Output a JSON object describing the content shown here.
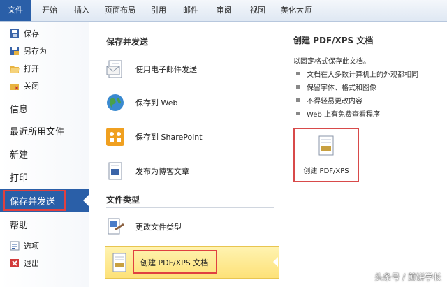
{
  "ribbon": {
    "tabs": [
      "文件",
      "开始",
      "插入",
      "页面布局",
      "引用",
      "邮件",
      "审阅",
      "视图",
      "美化大师"
    ]
  },
  "nav": {
    "small_items": [
      {
        "label": "保存",
        "icon": "save-icon"
      },
      {
        "label": "另存为",
        "icon": "save-as-icon"
      },
      {
        "label": "打开",
        "icon": "open-folder-icon"
      },
      {
        "label": "关闭",
        "icon": "close-folder-icon"
      }
    ],
    "big_items": [
      "信息",
      "最近所用文件",
      "新建",
      "打印",
      "保存并发送",
      "帮助"
    ],
    "bottom_items": [
      {
        "label": "选项",
        "icon": "options-icon"
      },
      {
        "label": "退出",
        "icon": "exit-icon"
      }
    ],
    "selected": "保存并发送"
  },
  "middle": {
    "section1_title": "保存并发送",
    "section1_items": [
      {
        "label": "使用电子邮件发送",
        "icon": "email-icon"
      },
      {
        "label": "保存到 Web",
        "icon": "globe-icon"
      },
      {
        "label": "保存到 SharePoint",
        "icon": "sharepoint-icon"
      },
      {
        "label": "发布为博客文章",
        "icon": "blog-icon"
      }
    ],
    "section2_title": "文件类型",
    "section2_items": [
      {
        "label": "更改文件类型",
        "icon": "change-type-icon"
      },
      {
        "label": "创建 PDF/XPS 文档",
        "icon": "pdf-doc-icon"
      }
    ]
  },
  "right": {
    "title": "创建 PDF/XPS 文档",
    "description": "以固定格式保存此文档。",
    "bullets": [
      "文档在大多数计算机上的外观都相同",
      "保留字体、格式和图像",
      "不得轻易更改内容",
      "Web 上有免费查看程序"
    ],
    "button_label": "创建 PDF/XPS"
  },
  "watermark": "头条号 / 煎饼学长",
  "colors": {
    "accent": "#2a5fa8",
    "highlight": "#fde178",
    "annotation_red": "#e04040"
  }
}
